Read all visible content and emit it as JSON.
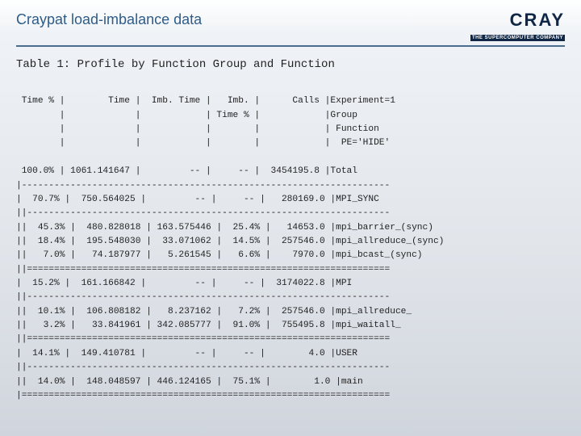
{
  "header": {
    "title": "Craypat load-imbalance data",
    "logo_main": "CRAY",
    "logo_sub": "THE SUPERCOMPUTER COMPANY"
  },
  "table": {
    "caption": "Table 1:  Profile by Function Group and Function",
    "columns": [
      "Time %",
      "Time",
      "Imb. Time",
      "Imb. Time %",
      "Calls",
      "Experiment=1 / Group / Function / PE='HIDE'"
    ],
    "header_lines": [
      " Time % |        Time |  Imb. Time |   Imb. |      Calls |Experiment=1",
      "        |             |            | Time % |            |Group",
      "        |             |            |        |            | Function",
      "        |             |            |        |            |  PE='HIDE'"
    ],
    "rows": [
      {
        "time_pct": "100.0%",
        "time": "1061.141647",
        "imb_time": "--",
        "imb_pct": "--",
        "calls": "3454195.8",
        "label": "Total"
      },
      {
        "time_pct": "70.7%",
        "time": "750.564025",
        "imb_time": "--",
        "imb_pct": "--",
        "calls": "280169.0",
        "label": "MPI_SYNC"
      },
      {
        "time_pct": "45.3%",
        "time": "480.828018",
        "imb_time": "163.575446",
        "imb_pct": "25.4%",
        "calls": "14653.0",
        "label": "mpi_barrier_(sync)"
      },
      {
        "time_pct": "18.4%",
        "time": "195.548030",
        "imb_time": "33.071062",
        "imb_pct": "14.5%",
        "calls": "257546.0",
        "label": "mpi_allreduce_(sync)"
      },
      {
        "time_pct": "7.0%",
        "time": "74.187977",
        "imb_time": "5.261545",
        "imb_pct": "6.6%",
        "calls": "7970.0",
        "label": "mpi_bcast_(sync)"
      },
      {
        "time_pct": "15.2%",
        "time": "161.166842",
        "imb_time": "--",
        "imb_pct": "--",
        "calls": "3174022.8",
        "label": "MPI"
      },
      {
        "time_pct": "10.1%",
        "time": "106.808182",
        "imb_time": "8.237162",
        "imb_pct": "7.2%",
        "calls": "257546.0",
        "label": "mpi_allreduce_"
      },
      {
        "time_pct": "3.2%",
        "time": "33.841961",
        "imb_time": "342.085777",
        "imb_pct": "91.0%",
        "calls": "755495.8",
        "label": "mpi_waitall_"
      },
      {
        "time_pct": "14.1%",
        "time": "149.410781",
        "imb_time": "--",
        "imb_pct": "--",
        "calls": "4.0",
        "label": "USER"
      },
      {
        "time_pct": "14.0%",
        "time": "148.048597",
        "imb_time": "446.124165",
        "imb_pct": "75.1%",
        "calls": "1.0",
        "label": "main"
      }
    ],
    "body_lines": [
      " 100.0% | 1061.141647 |         -- |     -- |  3454195.8 |Total",
      "|--------------------------------------------------------------------",
      "|  70.7% |  750.564025 |         -- |     -- |   280169.0 |MPI_SYNC",
      "||-------------------------------------------------------------------",
      "||  45.3% |  480.828018 | 163.575446 |  25.4% |   14653.0 |mpi_barrier_(sync)",
      "||  18.4% |  195.548030 |  33.071062 |  14.5% |  257546.0 |mpi_allreduce_(sync)",
      "||   7.0% |   74.187977 |   5.261545 |   6.6% |    7970.0 |mpi_bcast_(sync)",
      "||===================================================================",
      "|  15.2% |  161.166842 |         -- |     -- |  3174022.8 |MPI",
      "||-------------------------------------------------------------------",
      "||  10.1% |  106.808182 |   8.237162 |   7.2% |  257546.0 |mpi_allreduce_",
      "||   3.2% |   33.841961 | 342.085777 |  91.0% |  755495.8 |mpi_waitall_",
      "||===================================================================",
      "|  14.1% |  149.410781 |         -- |     -- |        4.0 |USER",
      "||-------------------------------------------------------------------",
      "||  14.0% |  148.048597 | 446.124165 |  75.1% |        1.0 |main",
      "|===================================================================="
    ]
  }
}
